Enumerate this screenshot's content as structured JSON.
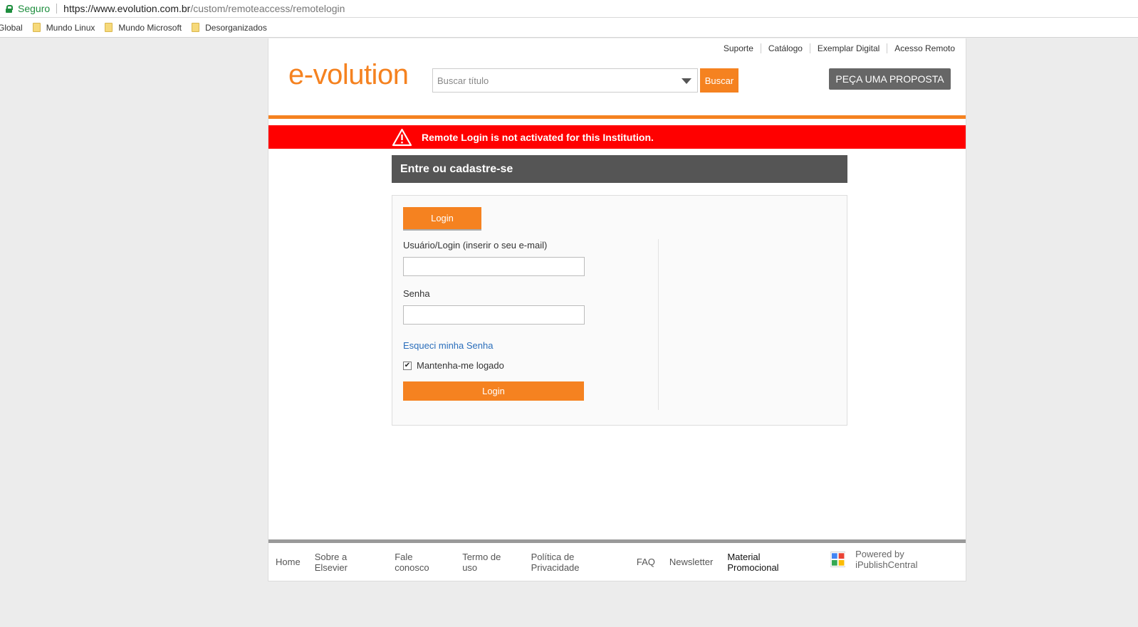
{
  "browser": {
    "secure_label": "Seguro",
    "url_host": "https://www.evolution.com.br",
    "url_path": "/custom/remoteaccess/remotelogin",
    "bookmarks": [
      "Global",
      "Mundo Linux",
      "Mundo Microsoft",
      "Desorganizados"
    ]
  },
  "header": {
    "top_links": [
      "Suporte",
      "Catálogo",
      "Exemplar Digital",
      "Acesso Remoto"
    ],
    "logo_text": "e-volution",
    "search_placeholder": "Buscar título",
    "search_button": "Buscar",
    "proposal_button": "PEÇA UMA PROPOSTA",
    "accent_color": "#f58220"
  },
  "alert": {
    "message": "Remote Login is not activated for this Institution.",
    "color": "#ff0000"
  },
  "login": {
    "panel_title": "Entre ou cadastre-se",
    "tab_label": "Login",
    "username_label": "Usuário/Login (inserir o seu e-mail)",
    "username_value": "",
    "password_label": "Senha",
    "password_value": "",
    "forgot_link": "Esqueci minha Senha",
    "remember_label": "Mantenha-me logado",
    "remember_checked": true,
    "submit_label": "Login"
  },
  "footer": {
    "links": [
      "Home",
      "Sobre a Elsevier",
      "Fale conosco",
      "Termo de uso",
      "Política de Privacidade",
      "FAQ",
      "Newsletter"
    ],
    "strong_link": "Material Promocional",
    "powered_by": "Powered by iPublishCentral"
  }
}
